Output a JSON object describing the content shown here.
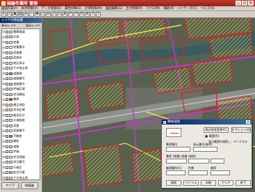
{
  "window": {
    "title": "国器作業所 管理",
    "btn_min": "_",
    "btn_max": "□",
    "btn_close": "×"
  },
  "menu": [
    "図面作業(F)",
    "表示制御(V)",
    "データ制御(D)",
    "属性制御(E)",
    "計測制御(M)",
    "図面編集(G)",
    "出力制御(P)",
    "マクロ(M)",
    "補助(R)",
    "ハイテータ(C)",
    "ヘルプ(H)"
  ],
  "toolbar_icons": [
    "pointer-icon",
    "open-icon",
    "save-icon",
    "print-icon",
    "zoom-in-icon",
    "zoom-out-icon",
    "pan-icon",
    "select-icon",
    "measure-icon",
    "line-icon",
    "polygon-icon",
    "text-icon",
    "undo-icon",
    "redo-icon",
    "refresh-icon",
    "layer-icon",
    "query-icon",
    "help-icon"
  ],
  "toolbar_glyphs": [
    "↖",
    "▭",
    "▪",
    "▤",
    "+",
    "-",
    "✥",
    "▢",
    "↔",
    "╱",
    "⬠",
    "A",
    "↶",
    "↷",
    "⟳",
    "≡",
    "?",
    "?"
  ],
  "left_panel": {
    "title": "レイヤ切替画面",
    "col_label": "表示レイヤ",
    "col_setting": "表示レイヤ",
    "layers": [
      {
        "label": "積算基図",
        "checked": false,
        "color": "#e8e8e8"
      },
      {
        "label": "区画",
        "checked": false,
        "color": "#f0e8b0"
      },
      {
        "label": "地番",
        "checked": false,
        "color": "#f0f0f0"
      },
      {
        "label": "地番番号",
        "checked": false,
        "color": "#ffffff"
      },
      {
        "label": "家屋番",
        "checked": false,
        "color": "#e0e0e0"
      },
      {
        "label": "家屋名",
        "checked": false,
        "color": "#e8d0d0"
      },
      {
        "label": "地区表示",
        "checked": false,
        "color": "#f8f0c0"
      },
      {
        "label": "その他土地",
        "checked": false,
        "color": "#ffffff"
      },
      {
        "label": "道路線",
        "checked": true,
        "color": "#d040d0"
      },
      {
        "label": "道路番号",
        "checked": false,
        "color": "#f0f0f0"
      },
      {
        "label": "道路番号",
        "checked": false,
        "color": "#e0c0e0"
      },
      {
        "label": "評価区域",
        "checked": false,
        "color": "#ffff80"
      },
      {
        "label": "状況類似",
        "checked": false,
        "color": "#c0e0f0"
      },
      {
        "label": "筆界",
        "checked": true,
        "color": "#e02020"
      },
      {
        "label": "補正項目",
        "checked": false,
        "color": "#f0d0a0"
      },
      {
        "label": "状況区域",
        "checked": false,
        "color": "#e0f0d0"
      },
      {
        "label": "集合区分",
        "checked": false,
        "color": "#f0f0f0"
      },
      {
        "label": "水道施設",
        "checked": false,
        "color": "#d0e0ff"
      },
      {
        "label": "家屋",
        "checked": false,
        "color": "#e0e0e0"
      },
      {
        "label": "家屋番号",
        "checked": false,
        "color": "#ffffff"
      },
      {
        "label": "不動産",
        "checked": true,
        "color": "#ff4040"
      },
      {
        "label": "補助",
        "checked": false,
        "color": "#f0f0f0"
      },
      {
        "label": "道路",
        "checked": false,
        "color": "#d0d0d0"
      },
      {
        "label": "評価",
        "checked": false,
        "color": "#f8e8a0"
      },
      {
        "label": "状況地図",
        "checked": false,
        "color": "#f0f0f0"
      },
      {
        "label": "状況番号",
        "checked": false,
        "color": "#e0e0f0"
      },
      {
        "label": "行政区",
        "checked": false,
        "color": "#f0d0d0"
      },
      {
        "label": "航空写真",
        "checked": false,
        "color": "#a0c0a0"
      },
      {
        "label": "その他土地",
        "checked": false,
        "color": "#ffffff"
      },
      {
        "label": "水路",
        "checked": false,
        "color": "#a0c0ff"
      }
    ],
    "btn_clear": "クリア",
    "btn_all": "再描画"
  },
  "dialog": {
    "title": "筆線調査",
    "btn_style": "表示形状変更(C)",
    "btn_option": "オプション(O)",
    "radio_label": "範囲(R)",
    "note": "表示範囲を検索し、マークする",
    "f1": "筆界番号",
    "f2": "表示番号(参考)",
    "f3": "筆界 (地番) 地番 (参照)",
    "f4": "範囲種別(C)",
    "f5": "件数",
    "f6": "順序",
    "btn_search": "検索",
    "btn_file": "ファイル",
    "btn_print": "印刷",
    "btn_clear": "クリア",
    "btn_close": "終了"
  }
}
